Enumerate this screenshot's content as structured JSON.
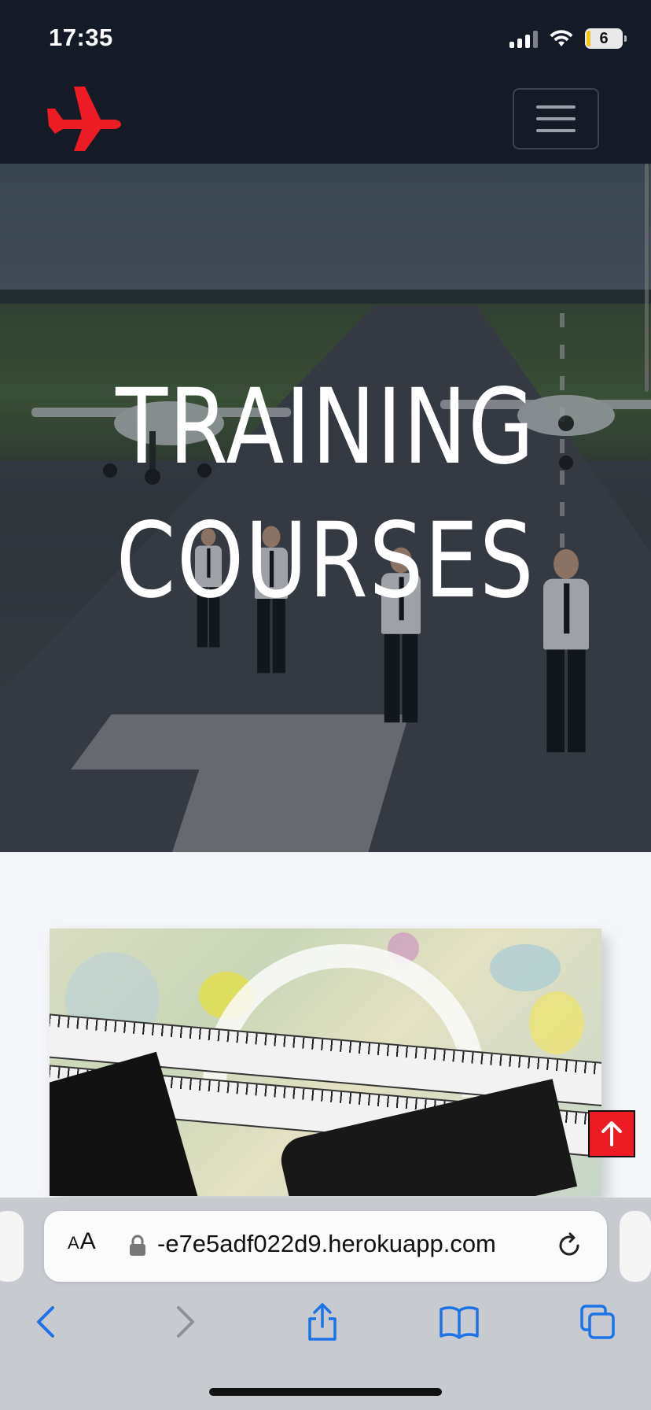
{
  "status_bar": {
    "time": "17:35",
    "battery_level": "6",
    "icons": [
      "cellular-signal-icon",
      "wifi-icon",
      "battery-icon"
    ]
  },
  "navbar": {
    "logo_icon": "airplane-icon",
    "logo_color": "#ed1c24",
    "menu_icon": "hamburger-menu-icon"
  },
  "hero": {
    "title_line1": "TRAINING",
    "title_line2": "COURSES"
  },
  "course_image": {
    "subject": "aviation-chart-with-plotter-image"
  },
  "scroll_top_button": {
    "icon": "arrow-up-icon",
    "color": "#ed1c24"
  },
  "browser": {
    "text_size_label_small": "A",
    "text_size_label_large": "A",
    "url": "-e7e5adf022d9.herokuapp.com",
    "lock_icon": "lock-icon",
    "reload_icon": "reload-icon",
    "toolbar": [
      "back-icon",
      "forward-icon",
      "share-icon",
      "bookmarks-icon",
      "tabs-icon"
    ],
    "accent_color": "#1a73e8"
  }
}
